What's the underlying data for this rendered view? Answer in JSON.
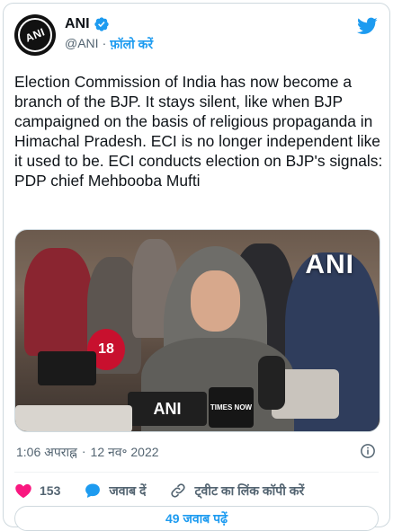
{
  "author": {
    "display_name": "ANI",
    "handle": "@ANI",
    "separator": "·",
    "follow_label": "फ़ॉलो करें",
    "avatar_text": "ANI"
  },
  "tweet": {
    "text": "Election Commission of India has now become a branch of the BJP. It stays silent, like when BJP campaigned on the basis of religious propaganda in Himachal Pradesh. ECI is no longer independent like it used to be. ECI conducts election on BJP's signals: PDP chief Mehbooba Mufti",
    "time": "1:06 अपराह्न",
    "time_separator": "·",
    "date": "12 नव॰ 2022"
  },
  "media": {
    "watermark": "ANI",
    "mic_labels": [
      "18",
      "ANI",
      "TIMES NOW"
    ]
  },
  "actions": {
    "like_count": "153",
    "reply_label": "जवाब दें",
    "copy_link_label": "ट्वीट का लिंक कॉपी करें"
  },
  "replies_button": "49 जवाब पढ़ें",
  "colors": {
    "accent": "#1d9bf0",
    "like": "#f91880",
    "text": "#0f1419",
    "muted": "#536471",
    "border": "#cfd9de"
  }
}
